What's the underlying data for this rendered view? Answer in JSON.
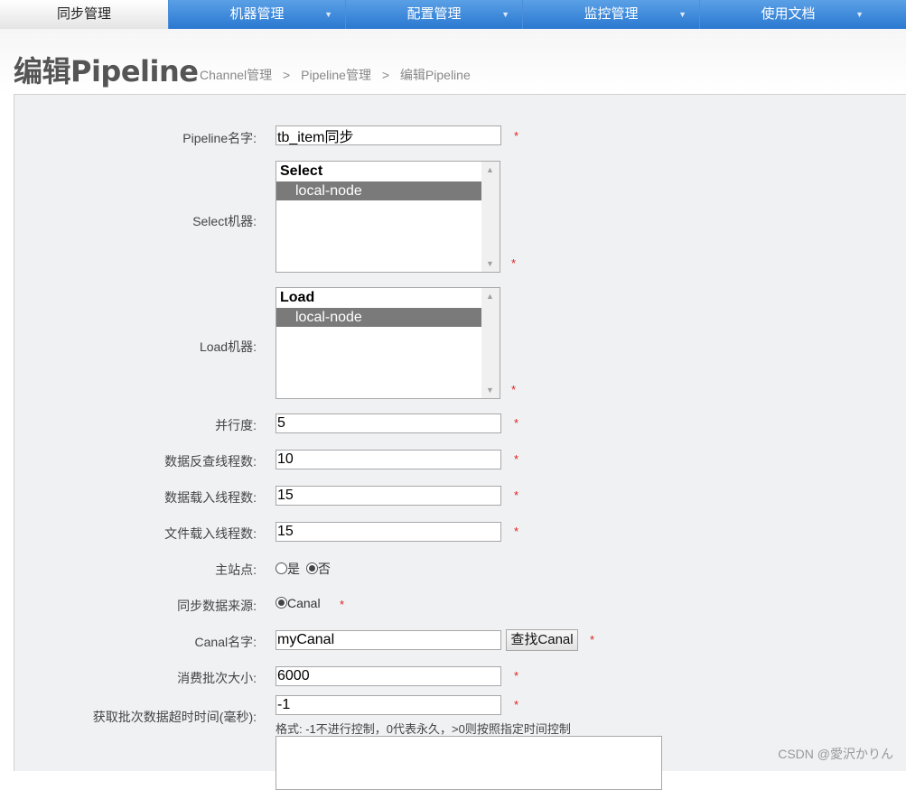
{
  "nav": {
    "tabs": [
      {
        "label": "同步管理",
        "active": true
      },
      {
        "label": "机器管理",
        "active": false
      },
      {
        "label": "配置管理",
        "active": false
      },
      {
        "label": "监控管理",
        "active": false
      },
      {
        "label": "使用文档",
        "active": false
      }
    ]
  },
  "header": {
    "title": "编辑Pipeline",
    "breadcrumb": [
      "Channel管理",
      "Pipeline管理",
      "编辑Pipeline"
    ],
    "separator": ">"
  },
  "form": {
    "required_mark": "*",
    "pipeline_name": {
      "label": "Pipeline名字:",
      "value": "tb_item同步"
    },
    "select_nodes": {
      "label": "Select机器:",
      "group": "Select",
      "options": [
        "local-node"
      ],
      "selected": "local-node"
    },
    "load_nodes": {
      "label": "Load机器:",
      "group": "Load",
      "options": [
        "local-node"
      ],
      "selected": "local-node"
    },
    "parallelism": {
      "label": "并行度:",
      "value": "5"
    },
    "extract_threads": {
      "label": "数据反查线程数:",
      "value": "10"
    },
    "load_threads": {
      "label": "数据载入线程数:",
      "value": "15"
    },
    "file_load_threads": {
      "label": "文件载入线程数:",
      "value": "15"
    },
    "main_station": {
      "label": "主站点:",
      "option_yes": "是",
      "option_no": "否",
      "selected": "否"
    },
    "data_source": {
      "label": "同步数据来源:",
      "option": "Canal",
      "selected": "Canal"
    },
    "canal_name": {
      "label": "Canal名字:",
      "value": "myCanal",
      "button": "查找Canal"
    },
    "batch_size": {
      "label": "消费批次大小:",
      "value": "6000"
    },
    "batch_timeout": {
      "label": "获取批次数据超时时间(毫秒):",
      "value": "-1",
      "hint": "格式: -1不进行控制，0代表永久，>0则按照指定时间控制"
    }
  },
  "watermark": "CSDN @愛沢かりん",
  "colors": {
    "nav_blue": "#2a78d0",
    "required": "#e02020",
    "selected_option": "#7a7a7a"
  }
}
